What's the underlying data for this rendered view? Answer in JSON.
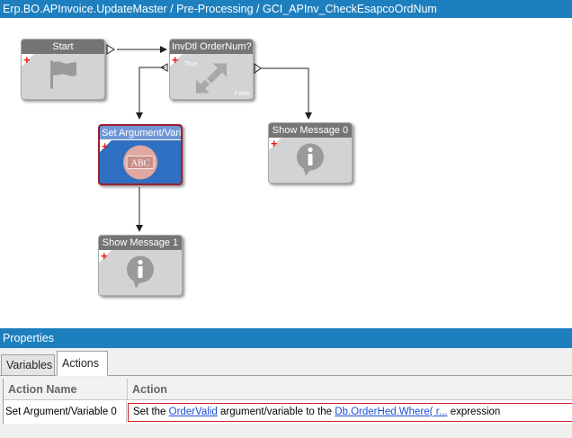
{
  "title_bar": {
    "path": "Erp.BO.APInvoice.UpdateMaster / Pre-Processing / GCI_APInv_CheckEsapcoOrdNum"
  },
  "workflow": {
    "nodes": {
      "start": {
        "title": "Start",
        "icon": "flag-icon"
      },
      "condition": {
        "title": "InvDtl OrderNum?",
        "true_label": "True",
        "false_label": "False",
        "icon": "branch-arrows-icon"
      },
      "set_arg": {
        "title": "Set Argument/Vari",
        "icon": "abc-icon",
        "icon_text": "ABC"
      },
      "show0": {
        "title": "Show Message 0",
        "icon": "info-bubble-icon"
      },
      "show1": {
        "title": "Show Message 1",
        "icon": "info-bubble-icon"
      }
    }
  },
  "properties": {
    "header": "Properties",
    "tabs": [
      {
        "label": "Variables"
      },
      {
        "label": "Actions",
        "active": true
      }
    ],
    "grid": {
      "columns": [
        "Action Name",
        "Action"
      ],
      "rows": [
        {
          "name": "Set Argument/Variable 0",
          "action": {
            "prefix": "Set the",
            "link1": "OrderValid",
            "middle": "argument/variable to the",
            "link2": "Db.OrderHed.Where( r...",
            "suffix": "expression"
          }
        }
      ]
    }
  },
  "colors": {
    "accent": "#1e7fbe",
    "node_header": "#757575",
    "node_body": "#d3d3d3",
    "selected_node": "#2f6fc1",
    "selected_border": "#9b1f2f",
    "link": "#1a4fd6"
  }
}
